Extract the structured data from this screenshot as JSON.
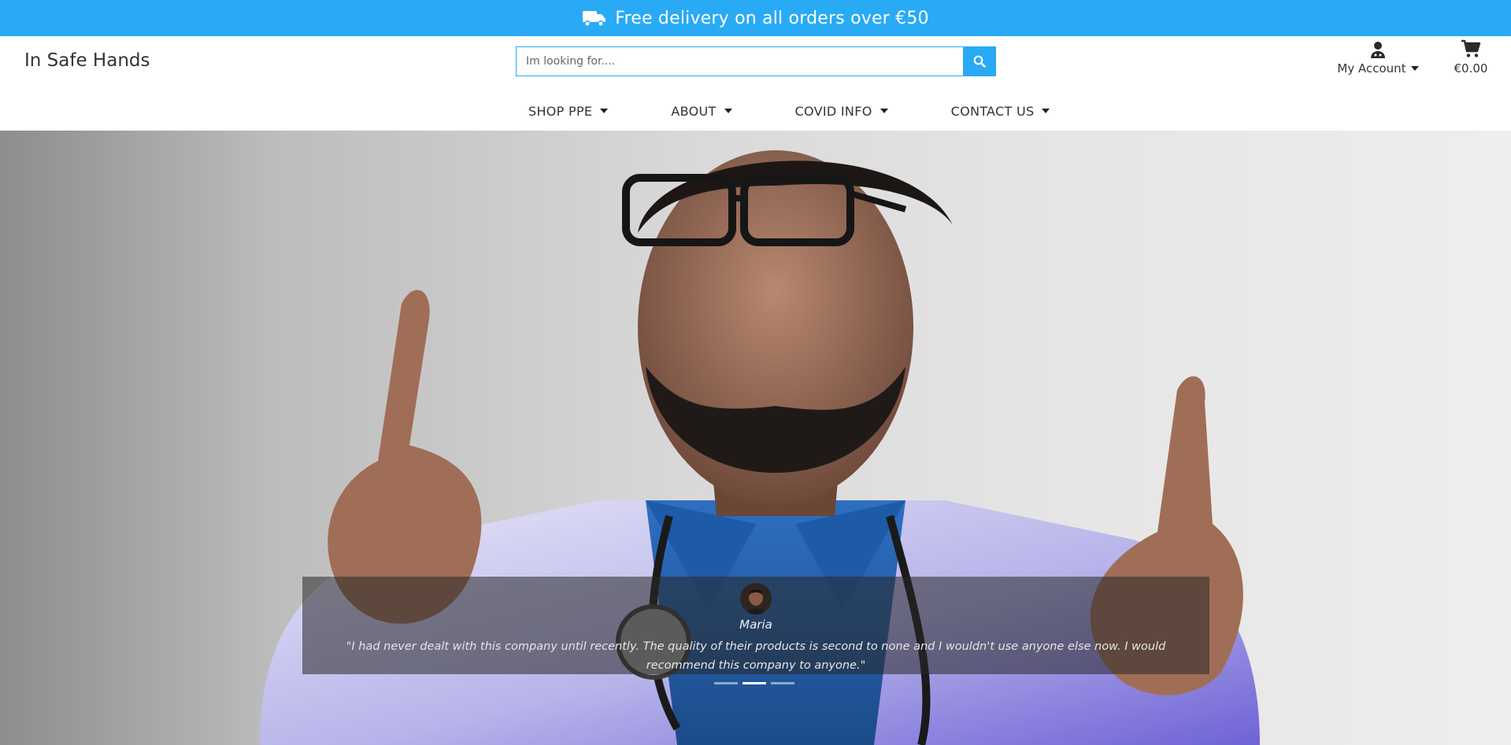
{
  "banner": {
    "icon": "truck-icon",
    "text": "Free delivery on all orders over €50"
  },
  "header": {
    "brand": "In Safe Hands",
    "search": {
      "placeholder": "Im looking for....",
      "value": "",
      "button_icon": "search-icon"
    },
    "account": {
      "icon": "doctor-user-icon",
      "label": "My Account"
    },
    "cart": {
      "icon": "shopping-cart-icon",
      "total": "€0.00"
    },
    "nav": [
      {
        "label": "SHOP PPE"
      },
      {
        "label": "ABOUT"
      },
      {
        "label": "COVID INFO"
      },
      {
        "label": "CONTACT US"
      }
    ]
  },
  "carousel": {
    "testimonial": {
      "name": "Maria",
      "quote": "\"I had never dealt with this company until recently. The quality of their products is second to none and I wouldn't use anyone else now. I would recommend this company to anyone.\""
    },
    "active_slide": 2,
    "slide_count": 3
  },
  "colors": {
    "accent": "#29aaf5",
    "text": "#333333"
  }
}
